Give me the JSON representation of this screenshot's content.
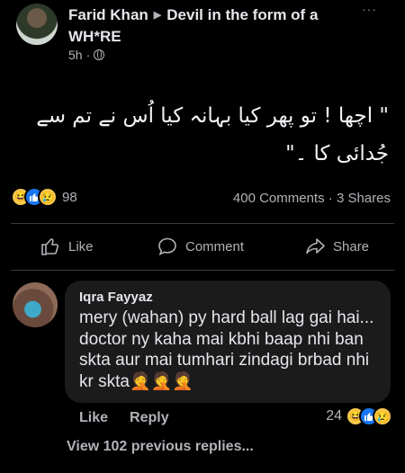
{
  "post": {
    "author": "Farid Khan",
    "group": "Devil in the form of a WH*RE",
    "time": "5h",
    "separator": "·",
    "more": "···",
    "text": "\" اچھا ! تو پھر کیا بہانہ کیا اُس نے تم سے جُدائی کا ۔\"",
    "reaction_count": "98",
    "comments_count": "400 Comments",
    "stats_dot": "·",
    "shares_count": "3 Shares"
  },
  "actions": {
    "like": "Like",
    "comment": "Comment",
    "share": "Share"
  },
  "comment": {
    "author": "Iqra Fayyaz",
    "text": "mery (wahan) py hard ball lag gai hai... doctor ny kaha mai kbhi baap nhi ban skta aur mai tumhari zindagi brbad nhi kr skta🤦🤦🤦",
    "like": "Like",
    "reply": "Reply",
    "reaction_count": "24",
    "view_previous": "View 102 previous replies..."
  },
  "colors": {
    "background": "#000000",
    "bubble": "#1b1b1c",
    "text": "#e4e6eb",
    "muted": "#b0b3b8",
    "like_blue": "#1877f2",
    "emoji_yellow": "#f7c94b"
  }
}
